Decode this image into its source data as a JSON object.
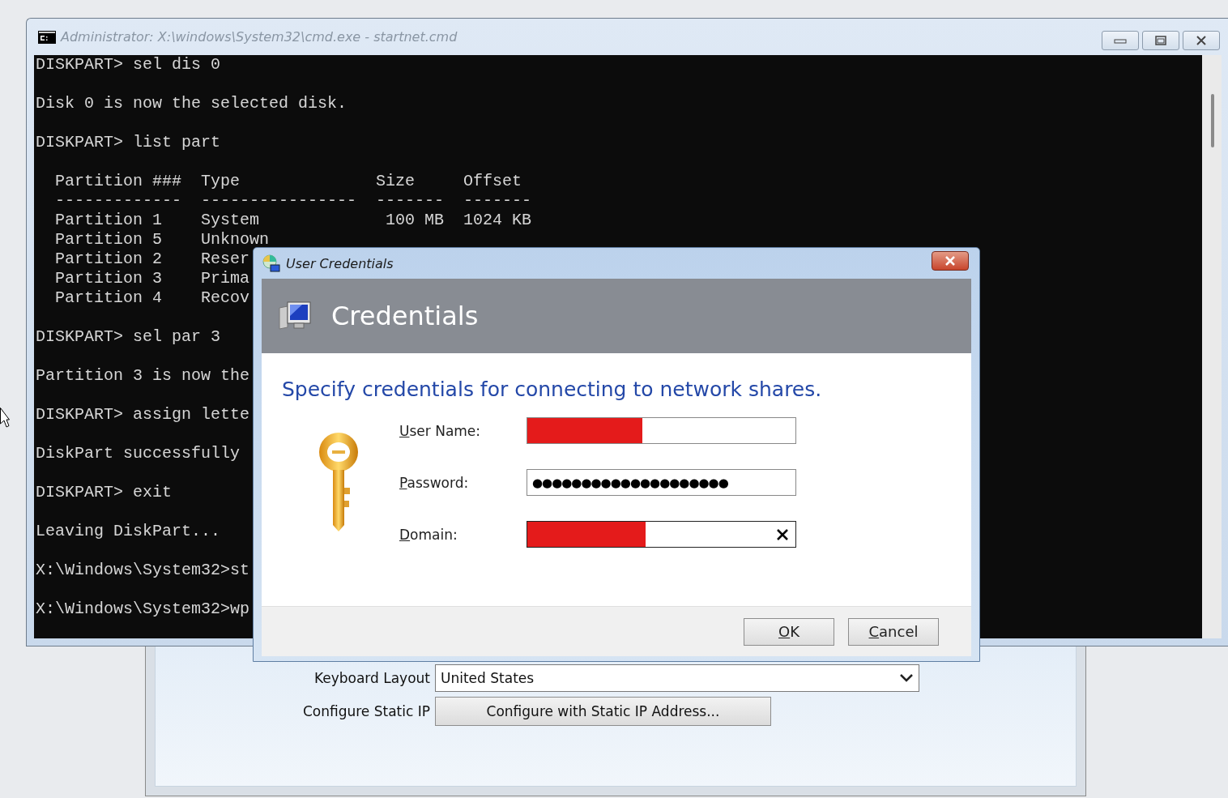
{
  "cmd_window": {
    "title": "Administrator: X:\\windows\\System32\\cmd.exe - startnet.cmd",
    "blocks": [
      [
        "DISKPART> sel dis 0"
      ],
      [
        "Disk 0 is now the selected disk."
      ],
      [
        "DISKPART> list part"
      ],
      [
        "  Partition ###  Type              Size     Offset",
        "  -------------  ----------------  -------  -------",
        "  Partition 1    System             100 MB  1024 KB",
        "  Partition 5    Unknown",
        "  Partition 2    Reser",
        "  Partition 3    Prima",
        "  Partition 4    Recov"
      ],
      [
        "DISKPART> sel par 3"
      ],
      [
        "Partition 3 is now the"
      ],
      [
        "DISKPART> assign lette"
      ],
      [
        "DiskPart successfully"
      ],
      [
        "DISKPART> exit"
      ],
      [
        "Leaving DiskPart..."
      ],
      [
        "X:\\Windows\\System32>st"
      ],
      [
        "X:\\Windows\\System32>wp"
      ]
    ]
  },
  "setup_window": {
    "rows": [
      {
        "kind": "dropdown",
        "label": "Keyboard Layout",
        "value": "United States"
      },
      {
        "kind": "button",
        "label": "Configure Static IP",
        "value": "Configure with Static IP Address..."
      }
    ]
  },
  "dialog": {
    "title": "User Credentials",
    "header": "Credentials",
    "instruction": "Specify credentials for connecting to network shares.",
    "fields": [
      {
        "kind": "redacted",
        "label": "User Name:"
      },
      {
        "kind": "password",
        "label": "Password:",
        "value": "●●●●●●●●●●●●●●●●●●●●"
      },
      {
        "kind": "redacted_clearable",
        "label": "Domain:"
      }
    ],
    "buttons": [
      "OK",
      "Cancel"
    ]
  }
}
